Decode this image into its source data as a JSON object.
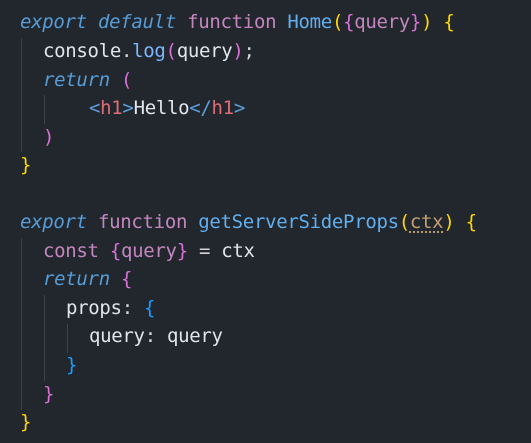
{
  "editor": {
    "lines": {
      "l1": {
        "export": "export",
        "default": "default",
        "function": "function",
        "name": "Home",
        "open_paren": "(",
        "open_brace": "{",
        "param": "query",
        "close_brace": "}",
        "close_paren": ")",
        "block_open": "{"
      },
      "l2": {
        "console": "console",
        "dot": ".",
        "log": "log",
        "open_paren": "(",
        "arg": "query",
        "close_paren": ")",
        "semi": ";"
      },
      "l3": {
        "return": "return",
        "open_paren": "("
      },
      "l4": {
        "lt1": "<",
        "tag1": "h1",
        "gt1": ">",
        "text": "Hello",
        "lt2": "</",
        "tag2": "h1",
        "gt2": ">"
      },
      "l5": {
        "close_paren": ")"
      },
      "l6": {
        "close_brace": "}"
      },
      "l8": {
        "export": "export",
        "function": "function",
        "name": "getServerSideProps",
        "open_paren": "(",
        "param": "ctx",
        "close_paren": ")",
        "block_open": "{"
      },
      "l9": {
        "const": "const",
        "open_brace": "{",
        "var": "query",
        "close_brace": "}",
        "equals": "=",
        "rhs": "ctx"
      },
      "l10": {
        "return": "return",
        "open_brace": "{"
      },
      "l11": {
        "key": "props",
        "colon": ":",
        "open_brace": "{"
      },
      "l12": {
        "key": "query",
        "colon": ":",
        "value": "query"
      },
      "l13": {
        "close_brace": "}"
      },
      "l14": {
        "close_brace": "}"
      },
      "l15": {
        "close_brace": "}"
      }
    }
  }
}
